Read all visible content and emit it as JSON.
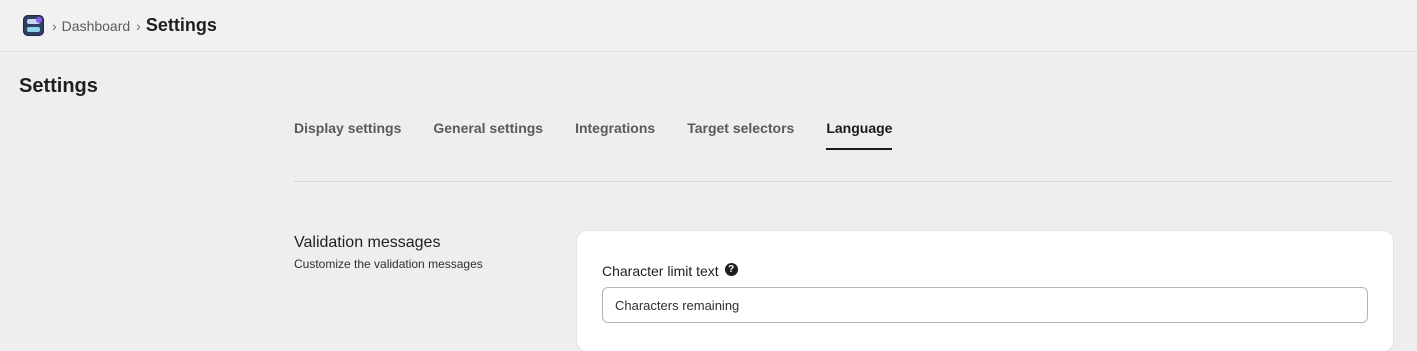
{
  "breadcrumb": {
    "separator": "›",
    "items": [
      "Dashboard"
    ],
    "current": "Settings"
  },
  "page": {
    "title": "Settings"
  },
  "tabs": [
    {
      "label": "Display settings",
      "active": false
    },
    {
      "label": "General settings",
      "active": false
    },
    {
      "label": "Integrations",
      "active": false
    },
    {
      "label": "Target selectors",
      "active": false
    },
    {
      "label": "Language",
      "active": true
    }
  ],
  "section": {
    "title": "Validation messages",
    "subtitle": "Customize the validation messages"
  },
  "fields": {
    "character_limit": {
      "label": "Character limit text",
      "help_icon": "?",
      "value": "Characters remaining"
    }
  }
}
